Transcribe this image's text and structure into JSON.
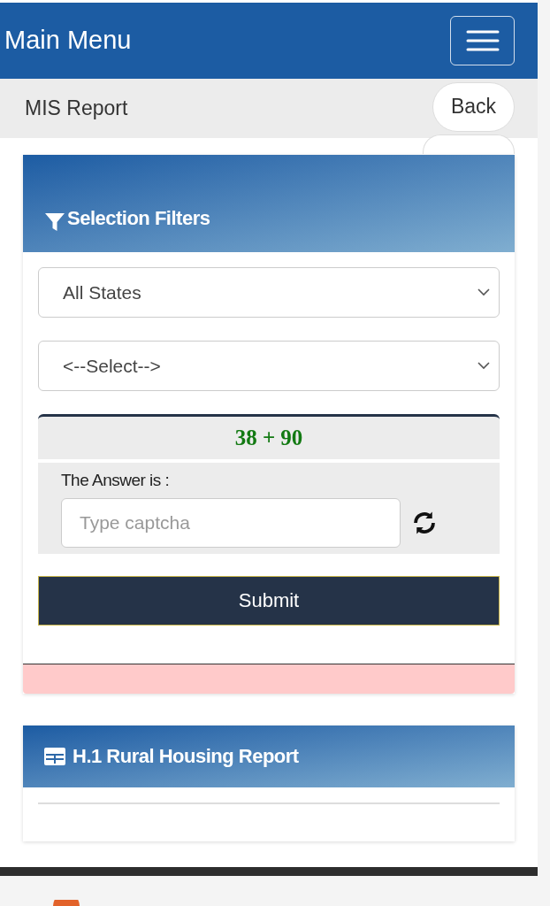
{
  "header": {
    "title": "Main Menu"
  },
  "breadcrumb": {
    "title": "MIS Report",
    "back_button": "Back"
  },
  "filters_card": {
    "title": "Selection Filters",
    "selects": [
      {
        "value": "All States"
      },
      {
        "value": "<--Select-->"
      }
    ],
    "captcha": {
      "question": "38 + 90",
      "label": "The Answer is :",
      "placeholder": "Type captcha"
    },
    "submit": "Submit"
  },
  "report_card": {
    "title": "H.1 Rural Housing Report"
  }
}
